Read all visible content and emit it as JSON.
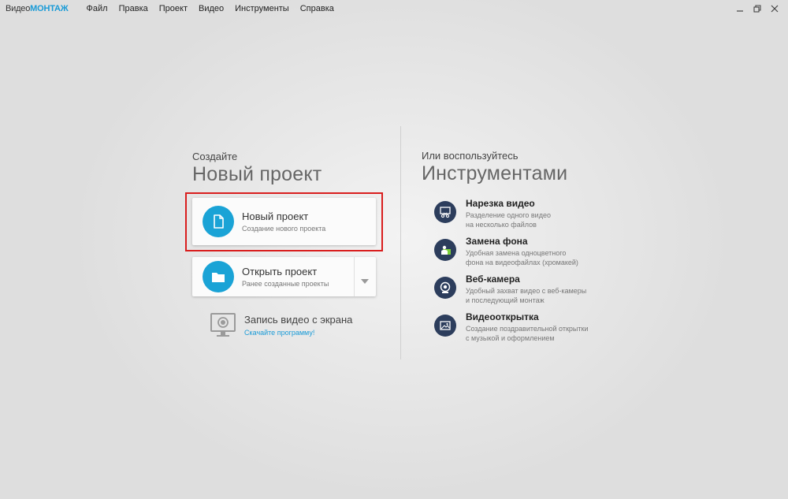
{
  "app": {
    "logo_part1": "Видео",
    "logo_part2": "МОНТАЖ"
  },
  "menu": [
    "Файл",
    "Правка",
    "Проект",
    "Видео",
    "Инструменты",
    "Справка"
  ],
  "left": {
    "kicker": "Создайте",
    "title": "Новый проект",
    "new_project": {
      "title": "Новый проект",
      "subtitle": "Создание нового проекта"
    },
    "open_project": {
      "title": "Открыть проект",
      "subtitle": "Ранее созданные проекты"
    },
    "record": {
      "title": "Запись видео с экрана",
      "link": "Скачайте программу!"
    }
  },
  "right": {
    "kicker": "Или воспользуйтесь",
    "title": "Инструментами",
    "tools": [
      {
        "title": "Нарезка видео",
        "line1": "Разделение одного видео",
        "line2": "на несколько файлов",
        "icon": "scissors-film-icon"
      },
      {
        "title": "Замена фона",
        "line1": "Удобная замена одноцветного",
        "line2": "фона на видеофайлах (хромакей)",
        "icon": "chroma-key-icon"
      },
      {
        "title": "Веб-камера",
        "line1": "Удобный захват видео с веб-камеры",
        "line2": "и последующий монтаж",
        "icon": "webcam-icon"
      },
      {
        "title": "Видеооткрытка",
        "line1": "Создание поздравительной открытки",
        "line2": "с музыкой и оформлением",
        "icon": "postcard-icon"
      }
    ]
  },
  "colors": {
    "accent": "#1aa3d6",
    "tool_circle": "#2c3d5c",
    "highlight": "#d91e1e",
    "link": "#1a9bd7"
  }
}
